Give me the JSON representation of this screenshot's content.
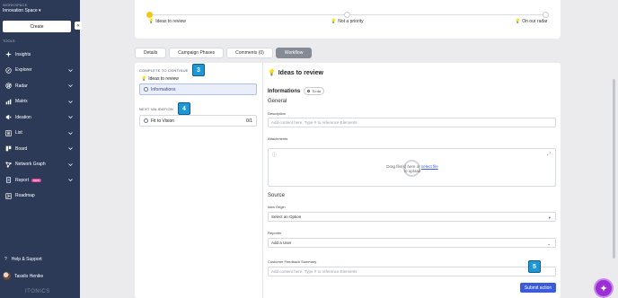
{
  "sidebar": {
    "workspace_label": "WORKSPACE",
    "workspace_name": "Innovation Space",
    "create_label": "Create",
    "collapse_glyph": "«",
    "tools_label": "TOOLS",
    "items": [
      {
        "label": "Insights",
        "icon": "sparkle-icon",
        "chevron": false
      },
      {
        "label": "Explorer",
        "icon": "compass-icon",
        "chevron": true
      },
      {
        "label": "Radar",
        "icon": "radar-icon",
        "chevron": true
      },
      {
        "label": "Matrix",
        "icon": "matrix-icon",
        "chevron": true
      },
      {
        "label": "Ideation",
        "icon": "megaphone-icon",
        "chevron": true
      },
      {
        "label": "List",
        "icon": "list-icon",
        "chevron": true
      },
      {
        "label": "Board",
        "icon": "board-icon",
        "chevron": true
      },
      {
        "label": "Network Graph",
        "icon": "network-icon",
        "chevron": true
      },
      {
        "label": "Report",
        "icon": "report-icon",
        "chevron": true,
        "badge": "NEW"
      },
      {
        "label": "Roadmap",
        "icon": "roadmap-icon",
        "chevron": false
      }
    ],
    "help_label": "Help & Support",
    "user_name": "Tassilo Henike",
    "brand": "ITONICS"
  },
  "stepper": {
    "steps": [
      {
        "label": "Ideas to review",
        "state": "active",
        "icon": "bulb-icon"
      },
      {
        "label": "Not a priority",
        "state": "inactive",
        "icon": "bulb-icon"
      },
      {
        "label": "On our radar",
        "state": "inactive",
        "icon": "bulb-icon"
      }
    ]
  },
  "tabs": [
    {
      "label": "Details",
      "active": false
    },
    {
      "label": "Campaign Phases",
      "active": false
    },
    {
      "label": "Comments (0)",
      "active": false
    },
    {
      "label": "Workflow",
      "active": true
    }
  ],
  "workflow": {
    "complete_label": "COMPLETE TO CONTINUE",
    "current_stage": "Ideas to review",
    "info_item": "Informations",
    "next_label": "NEXT VALIDATION",
    "next_item": "Fit to Vision",
    "next_count": "0/1"
  },
  "callouts": {
    "c3": "3",
    "c4": "4",
    "c5": "5"
  },
  "form": {
    "stage_title": "Ideas to review",
    "section_title": "Informations",
    "todo_label": "To do",
    "general_heading": "General",
    "description_label": "Description",
    "description_placeholder": "Add content here. Type # to reference Elements",
    "attachments_label": "Attachments",
    "dropzone_text": "Drag file(s) here or",
    "dropzone_link": "select file",
    "dropzone_tail": "to upload",
    "source_heading": "Source",
    "origin_label": "Idea Origin",
    "origin_value": "Select an Option",
    "reporter_label": "Reporter",
    "reporter_value": "Add a User",
    "feedback_label": "Customer Feedback Summary",
    "feedback_placeholder": "Add content here. Type # to reference Elements",
    "submit_label": "Submit action"
  },
  "colors": {
    "sidebar": "#2c3a57",
    "accent": "#3b5bdb",
    "callout": "#1d97d6",
    "active_step": "#f3c90f"
  }
}
